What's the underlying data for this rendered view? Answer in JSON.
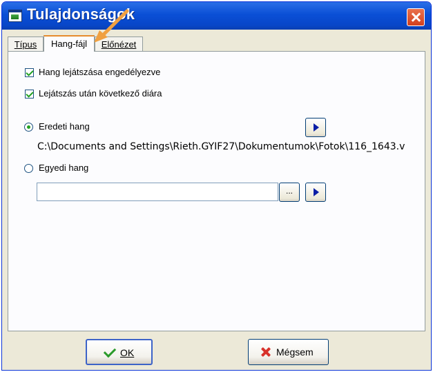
{
  "window": {
    "title": "Tulajdonságok"
  },
  "tabs": [
    {
      "label": "Típus",
      "active": false
    },
    {
      "label": "Hang-fájl",
      "active": true
    },
    {
      "label": "Előnézet",
      "active": false
    }
  ],
  "options": {
    "play_enabled": {
      "label": "Hang lejátszása engedélyezve",
      "checked": true
    },
    "next_slide": {
      "label": "Lejátszás után következő diára",
      "checked": true
    },
    "original_sound": {
      "label": "Eredeti hang",
      "selected": true
    },
    "original_path": "C:\\Documents and Settings\\Rieth.GYIF27\\Dokumentumok\\Fotok\\116_1643.v",
    "custom_sound": {
      "label": "Egyedi hang",
      "selected": false
    },
    "custom_path": {
      "value": "",
      "placeholder": ""
    },
    "browse_label": "..."
  },
  "footer": {
    "ok_label": "OK",
    "cancel_label": "Mégsem"
  },
  "colors": {
    "titlebar": "#0a4fd6",
    "annotation_arrow": "#f0a040",
    "check": "#21a121",
    "play": "#0a1ea6"
  }
}
